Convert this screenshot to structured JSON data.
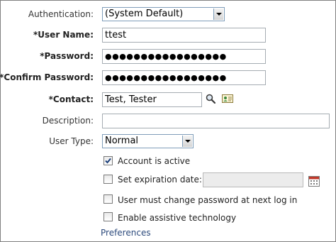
{
  "form": {
    "authentication": {
      "label": "Authentication:",
      "selected": "(System Default)"
    },
    "user_name": {
      "label": "*User Name:",
      "value": "ttest"
    },
    "password": {
      "label": "*Password:",
      "masked": "●●●●●●●●●●●●●●●●●"
    },
    "confirm_password": {
      "label": "*Confirm Password:",
      "masked": "●●●●●●●●●●●●●●●●●"
    },
    "contact": {
      "label": "*Contact:",
      "value": "Test, Tester",
      "search_icon": "magnifier-icon",
      "card_icon": "contact-card-icon"
    },
    "description": {
      "label": "Description:",
      "value": ""
    },
    "user_type": {
      "label": "User Type:",
      "selected": "Normal"
    },
    "account_active": {
      "label": "Account is active",
      "checked": true
    },
    "expiration": {
      "label": "Set expiration date:",
      "checked": false,
      "value": "",
      "calendar_icon": "calendar-icon"
    },
    "must_change_password": {
      "label": "User must change password at next log in",
      "checked": false
    },
    "assistive_tech": {
      "label": "Enable assistive technology",
      "checked": false
    },
    "preferences_link": "Preferences"
  },
  "colors": {
    "border": "#a5acb2",
    "select_border": "#7f9db9",
    "link": "#2c4a7c",
    "disabled_field": "#ececec"
  }
}
